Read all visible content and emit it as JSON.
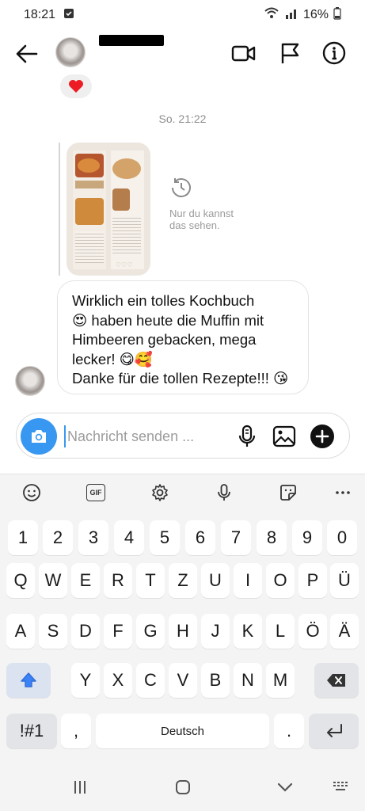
{
  "status_bar": {
    "time": "18:21",
    "battery": "16%"
  },
  "header": {
    "username": "",
    "icons": [
      "back-arrow-icon",
      "video-camera-icon",
      "flag-icon",
      "info-icon"
    ]
  },
  "reaction": {
    "emoji": "❤️"
  },
  "date_separator": "So. 21:22",
  "shared_media": {
    "hidden_line1": "Nur du kannst",
    "hidden_line2": "das sehen."
  },
  "message": {
    "line1": "Wirklich ein tolles Kochbuch",
    "line2": "😍 haben heute die Muffin mit",
    "line3": "Himbeeren gebacken, mega",
    "line4": "lecker! 😋🥰",
    "line5": "Danke für die tollen Rezepte!!! 😘"
  },
  "composer": {
    "placeholder": "Nachricht senden ..."
  },
  "keyboard": {
    "toolbar": [
      "emoji-icon",
      "GIF",
      "settings-icon",
      "mic-icon",
      "sticker-icon",
      "more-icon"
    ],
    "gif_label": "GIF",
    "number_row": [
      "1",
      "2",
      "3",
      "4",
      "5",
      "6",
      "7",
      "8",
      "9",
      "0"
    ],
    "row1": [
      "Q",
      "W",
      "E",
      "R",
      "T",
      "Z",
      "U",
      "I",
      "O",
      "P",
      "Ü"
    ],
    "row2": [
      "A",
      "S",
      "D",
      "F",
      "G",
      "H",
      "J",
      "K",
      "L",
      "Ö",
      "Ä"
    ],
    "row3": [
      "Y",
      "X",
      "C",
      "V",
      "B",
      "N",
      "M"
    ],
    "symbols_label": "!#1",
    "comma": ",",
    "space_label": "Deutsch",
    "period": "."
  },
  "nav_bar": [
    "recent-apps-icon",
    "home-icon",
    "back-icon",
    "keyboard-switch-icon"
  ],
  "colors": {
    "accent": "#3897f0",
    "heart": "#ed4956"
  }
}
